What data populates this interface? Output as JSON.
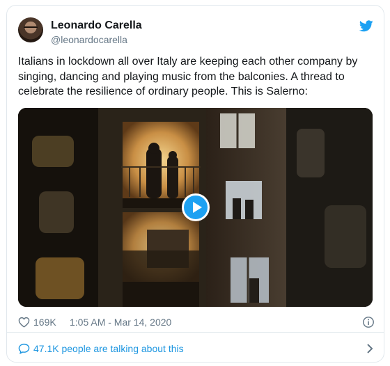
{
  "author": {
    "name": "Leonardo Carella",
    "handle": "@leonardocarella"
  },
  "tweet": {
    "text": "Italians in lockdown all over Italy are keeping each other company by singing, dancing and playing music from the balconies. A thread to celebrate the resilience of ordinary people. This is Salerno:"
  },
  "stats": {
    "likes": "169K",
    "timestamp": "1:05 AM - Mar 14, 2020"
  },
  "conversation": {
    "label": "47.1K people are talking about this"
  },
  "colors": {
    "twitter_blue": "#1da1f2",
    "link_blue": "#1b95e0",
    "secondary_text": "#657786",
    "border": "#e1e8ed"
  },
  "icons": [
    "twitter-bird-icon",
    "play-icon",
    "heart-icon",
    "info-icon",
    "speech-bubble-icon",
    "chevron-right-icon"
  ]
}
